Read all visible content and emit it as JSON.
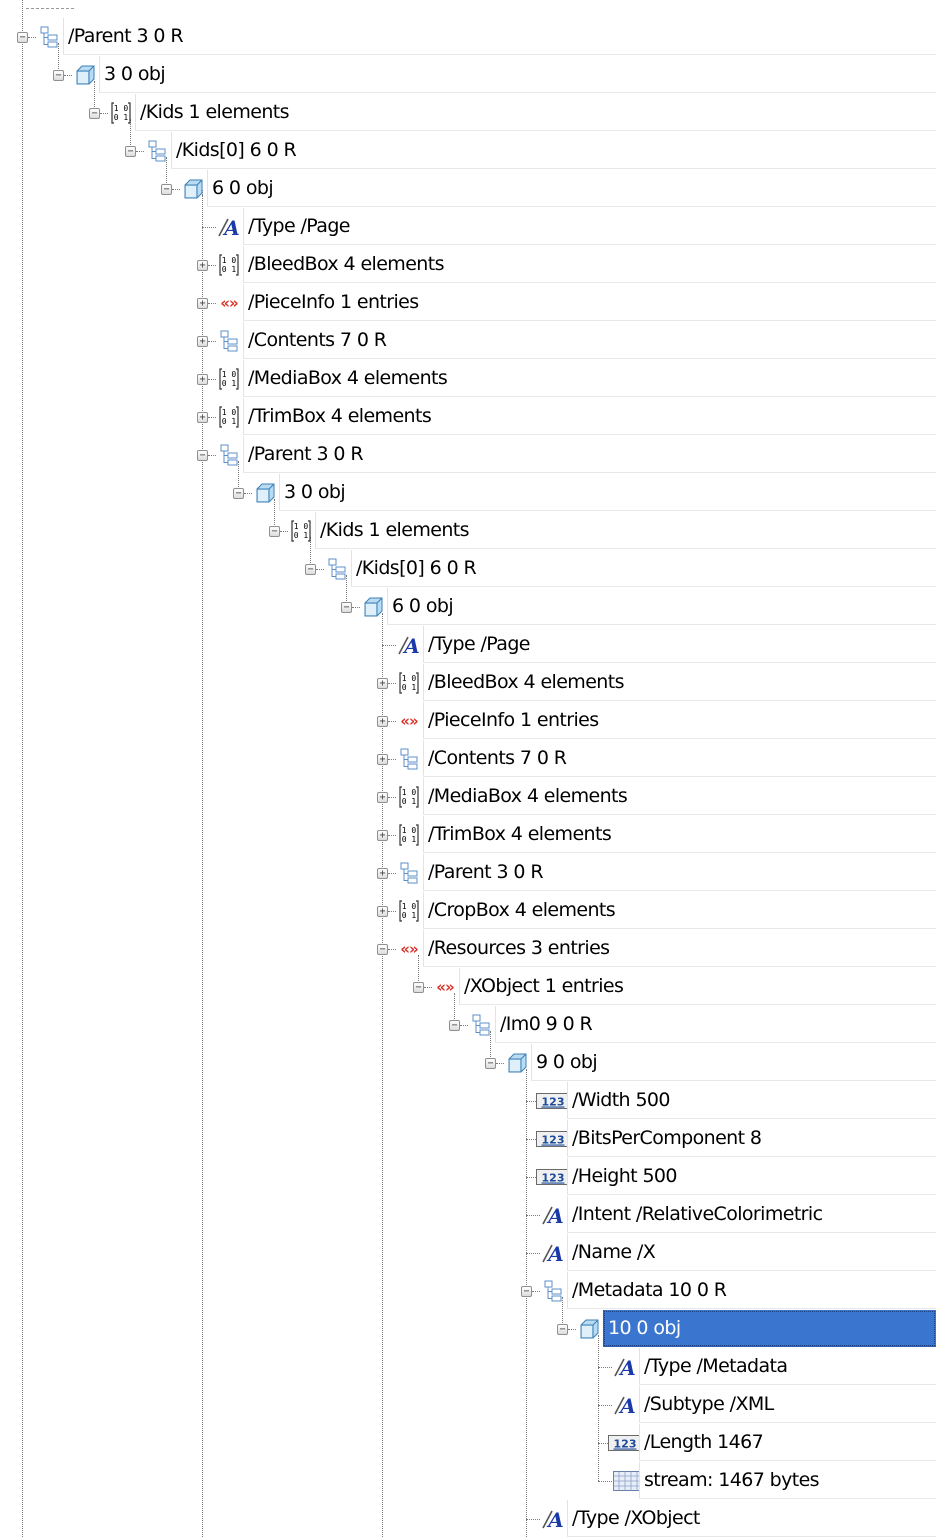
{
  "tree": {
    "selected_row": 34,
    "icon_legend": {
      "ref": "reference-icon",
      "obj": "object-cube-icon",
      "arr": "array-icon",
      "name": "name-icon",
      "dict": "dictionary-icon",
      "num": "number-icon",
      "stream": "stream-icon"
    },
    "rows": [
      {
        "depth": 0,
        "toggle": "minus",
        "icon": "ref",
        "label": "/Parent 3 0 R"
      },
      {
        "depth": 1,
        "toggle": "minus",
        "icon": "obj",
        "label": "3 0 obj"
      },
      {
        "depth": 2,
        "toggle": "minus",
        "icon": "arr",
        "label": "/Kids 1 elements"
      },
      {
        "depth": 3,
        "toggle": "minus",
        "icon": "ref",
        "label": "/Kids[0] 6 0 R"
      },
      {
        "depth": 4,
        "toggle": "minus",
        "icon": "obj",
        "label": "6 0 obj"
      },
      {
        "depth": 5,
        "toggle": "none",
        "icon": "name",
        "label": "/Type /Page"
      },
      {
        "depth": 5,
        "toggle": "plus",
        "icon": "arr",
        "label": "/BleedBox 4 elements"
      },
      {
        "depth": 5,
        "toggle": "plus",
        "icon": "dict",
        "label": "/PieceInfo 1 entries"
      },
      {
        "depth": 5,
        "toggle": "plus",
        "icon": "ref",
        "label": "/Contents 7 0 R"
      },
      {
        "depth": 5,
        "toggle": "plus",
        "icon": "arr",
        "label": "/MediaBox 4 elements"
      },
      {
        "depth": 5,
        "toggle": "plus",
        "icon": "arr",
        "label": "/TrimBox 4 elements"
      },
      {
        "depth": 5,
        "toggle": "minus",
        "icon": "ref",
        "label": "/Parent 3 0 R"
      },
      {
        "depth": 6,
        "toggle": "minus",
        "icon": "obj",
        "label": "3 0 obj"
      },
      {
        "depth": 7,
        "toggle": "minus",
        "icon": "arr",
        "label": "/Kids 1 elements"
      },
      {
        "depth": 8,
        "toggle": "minus",
        "icon": "ref",
        "label": "/Kids[0] 6 0 R"
      },
      {
        "depth": 9,
        "toggle": "minus",
        "icon": "obj",
        "label": "6 0 obj"
      },
      {
        "depth": 10,
        "toggle": "none",
        "icon": "name",
        "label": "/Type /Page"
      },
      {
        "depth": 10,
        "toggle": "plus",
        "icon": "arr",
        "label": "/BleedBox 4 elements"
      },
      {
        "depth": 10,
        "toggle": "plus",
        "icon": "dict",
        "label": "/PieceInfo 1 entries"
      },
      {
        "depth": 10,
        "toggle": "plus",
        "icon": "ref",
        "label": "/Contents 7 0 R"
      },
      {
        "depth": 10,
        "toggle": "plus",
        "icon": "arr",
        "label": "/MediaBox 4 elements"
      },
      {
        "depth": 10,
        "toggle": "plus",
        "icon": "arr",
        "label": "/TrimBox 4 elements"
      },
      {
        "depth": 10,
        "toggle": "plus",
        "icon": "ref",
        "label": "/Parent 3 0 R"
      },
      {
        "depth": 10,
        "toggle": "plus",
        "icon": "arr",
        "label": "/CropBox 4 elements"
      },
      {
        "depth": 10,
        "toggle": "minus",
        "icon": "dict",
        "label": "/Resources 3 entries"
      },
      {
        "depth": 11,
        "toggle": "minus",
        "icon": "dict",
        "label": "/XObject 1 entries"
      },
      {
        "depth": 12,
        "toggle": "minus",
        "icon": "ref",
        "label": "/Im0 9 0 R"
      },
      {
        "depth": 13,
        "toggle": "minus",
        "icon": "obj",
        "label": "9 0 obj"
      },
      {
        "depth": 14,
        "toggle": "none",
        "icon": "num",
        "label": "/Width 500"
      },
      {
        "depth": 14,
        "toggle": "none",
        "icon": "num",
        "label": "/BitsPerComponent 8"
      },
      {
        "depth": 14,
        "toggle": "none",
        "icon": "num",
        "label": "/Height 500"
      },
      {
        "depth": 14,
        "toggle": "none",
        "icon": "name",
        "label": "/Intent /RelativeColorimetric"
      },
      {
        "depth": 14,
        "toggle": "none",
        "icon": "name",
        "label": "/Name /X"
      },
      {
        "depth": 14,
        "toggle": "minus",
        "icon": "ref",
        "label": "/Metadata 10 0 R"
      },
      {
        "depth": 15,
        "toggle": "minus",
        "icon": "obj",
        "label": "10 0 obj"
      },
      {
        "depth": 16,
        "toggle": "none",
        "icon": "name",
        "label": "/Type /Metadata"
      },
      {
        "depth": 16,
        "toggle": "none",
        "icon": "name",
        "label": "/Subtype /XML"
      },
      {
        "depth": 16,
        "toggle": "none",
        "icon": "num",
        "label": "/Length 1467"
      },
      {
        "depth": 16,
        "toggle": "none",
        "icon": "stream",
        "label": "stream: 1467 bytes"
      },
      {
        "depth": 14,
        "toggle": "none",
        "icon": "name",
        "label": "/Type /XObject"
      }
    ],
    "icon_text": {
      "arr_top": "1 0",
      "arr_bottom": "0 1",
      "dict": "«»",
      "num": "123",
      "name": "A",
      "toggle_plus": "+",
      "toggle_minus": "−"
    },
    "colors": {
      "selection": "#3a76d0",
      "dict_icon": "#d8332a",
      "ref_icon": "#5b8fc9",
      "name_icon": "#1a3aa8"
    }
  }
}
